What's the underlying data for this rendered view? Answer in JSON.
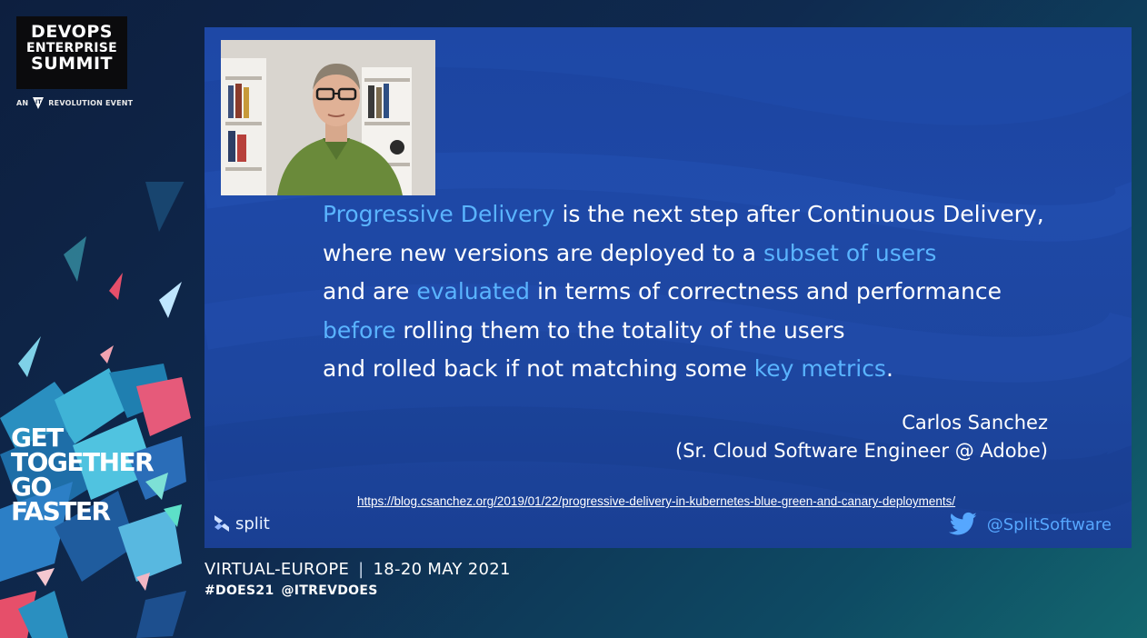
{
  "logo": {
    "line1": "DEVOPS",
    "line2": "ENTERPRISE",
    "line3": "SUMMIT",
    "event_prefix": "AN",
    "event_brand": "REVOLUTION",
    "event_suffix": "EVENT"
  },
  "tagline": [
    "GET",
    "TOGETHER",
    "GO",
    "FASTER"
  ],
  "slide": {
    "quote": [
      [
        {
          "t": "Progressive Delivery",
          "hl": true
        },
        {
          "t": " is the next step after Continuous Delivery,",
          "hl": false
        }
      ],
      [
        {
          "t": "where new versions are deployed to a ",
          "hl": false
        },
        {
          "t": "subset of users",
          "hl": true
        }
      ],
      [
        {
          "t": "and are ",
          "hl": false
        },
        {
          "t": "evaluated",
          "hl": true
        },
        {
          "t": " in terms of correctness and performance",
          "hl": false
        }
      ],
      [
        {
          "t": "before",
          "hl": true
        },
        {
          "t": " rolling them to the totality of the users",
          "hl": false
        }
      ],
      [
        {
          "t": "and rolled back if not matching some ",
          "hl": false
        },
        {
          "t": "key metrics",
          "hl": true
        },
        {
          "t": ".",
          "hl": false
        }
      ]
    ],
    "author_name": "Carlos Sanchez",
    "author_title": "(Sr. Cloud Software Engineer @ Adobe)",
    "source_url": "https://blog.csanchez.org/2019/01/22/progressive-delivery-in-kubernetes-blue-green-and-canary-deployments/",
    "brand": "split",
    "twitter_handle": "@SplitSoftware",
    "highlight_color": "#5ab4ff",
    "background_color": "#1d46a2"
  },
  "footer": {
    "location": "VIRTUAL-EUROPE",
    "separator": "|",
    "dates": "18-20 MAY 2021",
    "hashtag": "#DOES21",
    "handle": "@ITREVDOES"
  },
  "icons": {
    "event_logo": "it-revolution-icon",
    "speaker": "speaker-video",
    "brand": "split-logo-icon",
    "twitter": "twitter-bird-icon"
  }
}
